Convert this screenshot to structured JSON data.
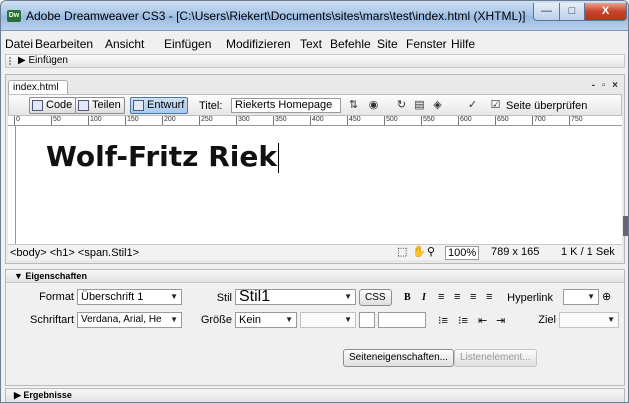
{
  "window": {
    "title": "Adobe Dreamweaver CS3 - [C:\\Users\\Riekert\\Documents\\sites\\mars\\test\\index.html (XHTML)]",
    "app_icon": "Dw",
    "minimize": "—",
    "maximize": "□",
    "close": "X"
  },
  "menu": [
    "Datei",
    "Bearbeiten",
    "Ansicht",
    "Einfügen",
    "Modifizieren",
    "Text",
    "Befehle",
    "Site",
    "Fenster",
    "Hilfe"
  ],
  "insert_bar": {
    "label": "Einfügen"
  },
  "document": {
    "tab": "index.html",
    "window_controls": "- ▫ ×",
    "toolbar": {
      "code": "Code",
      "split": "Teilen",
      "design": "Entwurf",
      "title_label": "Titel:",
      "title_value": "Riekerts Homepage",
      "check_page": "Seite überprüfen"
    },
    "ruler_labels": [
      "0",
      "50",
      "100",
      "150",
      "200",
      "250",
      "300",
      "350",
      "400",
      "450",
      "500",
      "550",
      "600",
      "650",
      "700",
      "750"
    ],
    "heading": "Wolf-Fritz Riek"
  },
  "statusbar": {
    "tag_selector": "<body> <h1> <span.Stil1>",
    "zoom": "100%",
    "dimensions": "789 x 165",
    "size_time": "1 K / 1 Sek"
  },
  "properties": {
    "header": "Eigenschaften",
    "format_label": "Format",
    "format_value": "Überschrift 1",
    "style_label": "Stil",
    "style_value": "Stil1",
    "css_button": "CSS",
    "bold": "B",
    "italic": "I",
    "link_label": "Hyperlink",
    "font_label": "Schriftart",
    "font_value": "Verdana, Arial, He",
    "size_label": "Größe",
    "size_value": "Kein",
    "target_label": "Ziel",
    "page_props_button": "Seiteneigenschaften...",
    "list_item_button": "Listenelement..."
  },
  "results": {
    "label": "Ergebnisse"
  },
  "colors": {
    "titlebar": "#a9c6e8",
    "close_button": "#c8432a",
    "active_view": "#a9c9ec"
  }
}
